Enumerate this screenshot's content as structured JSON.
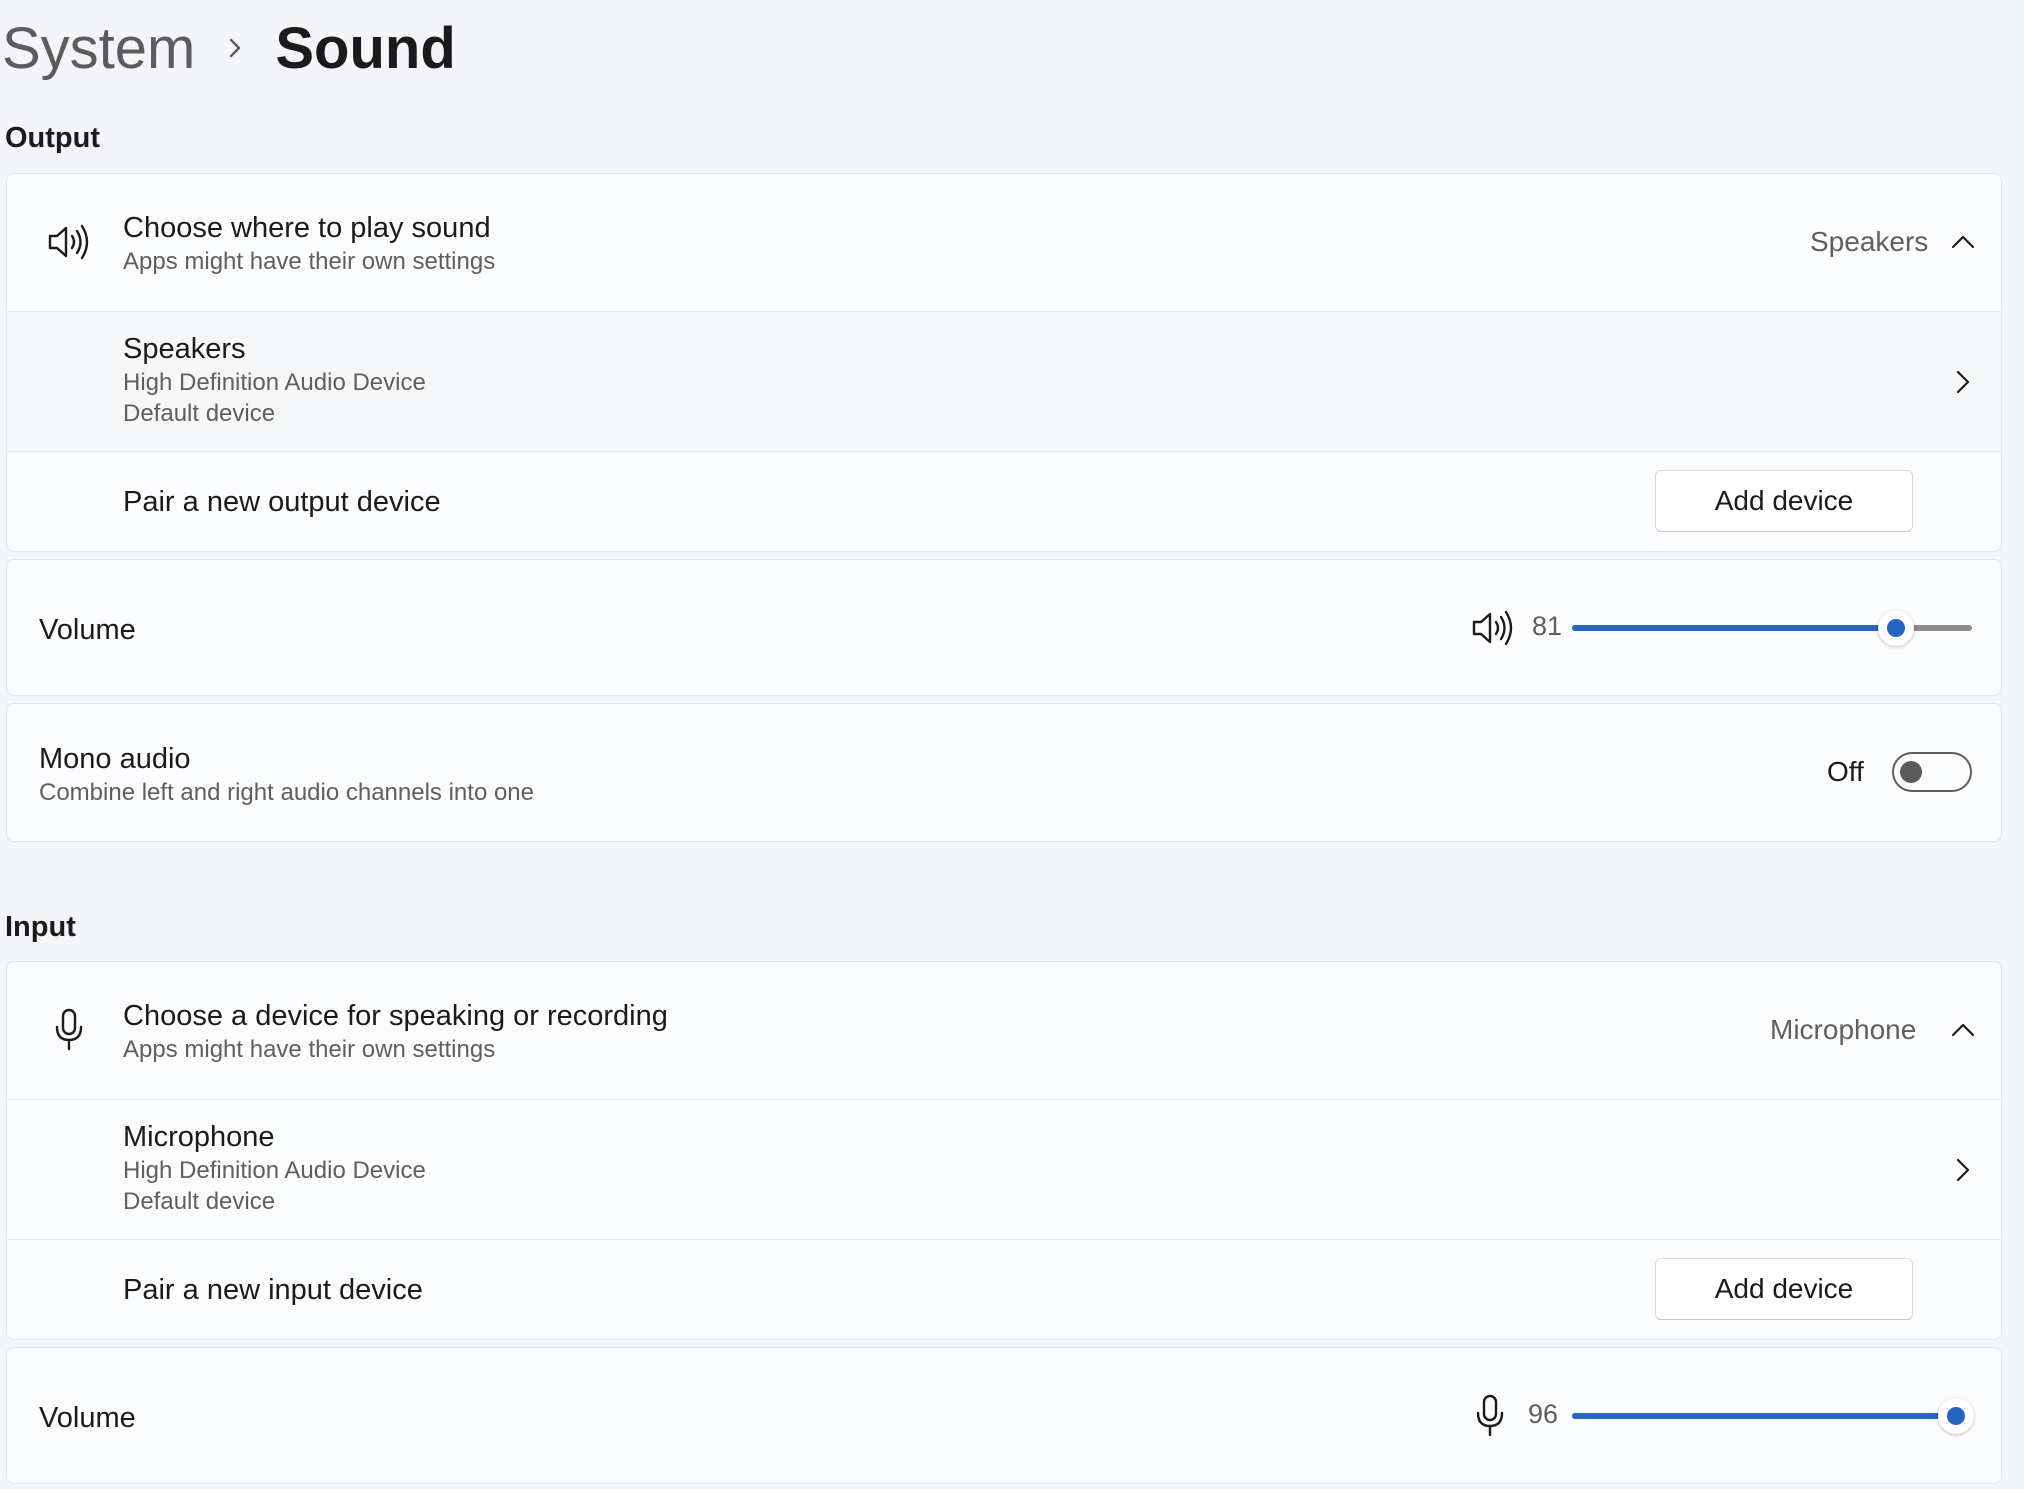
{
  "breadcrumb": {
    "parent": "System",
    "current": "Sound"
  },
  "output": {
    "section_title": "Output",
    "choose": {
      "icon": "speaker-icon",
      "title": "Choose where to play sound",
      "subtitle": "Apps might have their own settings",
      "selected": "Speakers"
    },
    "device": {
      "name": "Speakers",
      "description": "High Definition Audio Device",
      "status": "Default device"
    },
    "pair": {
      "label": "Pair a new output device",
      "button": "Add device"
    },
    "volume": {
      "label": "Volume",
      "icon": "speaker-icon",
      "value": "81",
      "level": 81
    },
    "mono": {
      "title": "Mono audio",
      "subtitle": "Combine left and right audio channels into one",
      "state": "Off",
      "on": false
    }
  },
  "input": {
    "section_title": "Input",
    "choose": {
      "icon": "microphone-icon",
      "title": "Choose a device for speaking or recording",
      "subtitle": "Apps might have their own settings",
      "selected": "Microphone"
    },
    "device": {
      "name": "Microphone",
      "description": "High Definition Audio Device",
      "status": "Default device"
    },
    "pair": {
      "label": "Pair a new input device",
      "button": "Add device"
    },
    "volume": {
      "label": "Volume",
      "icon": "microphone-icon",
      "value": "96",
      "level": 96
    }
  },
  "colors": {
    "accent": "#2766c1",
    "background": "#f3f5f9",
    "card": "#fbfcfe"
  }
}
